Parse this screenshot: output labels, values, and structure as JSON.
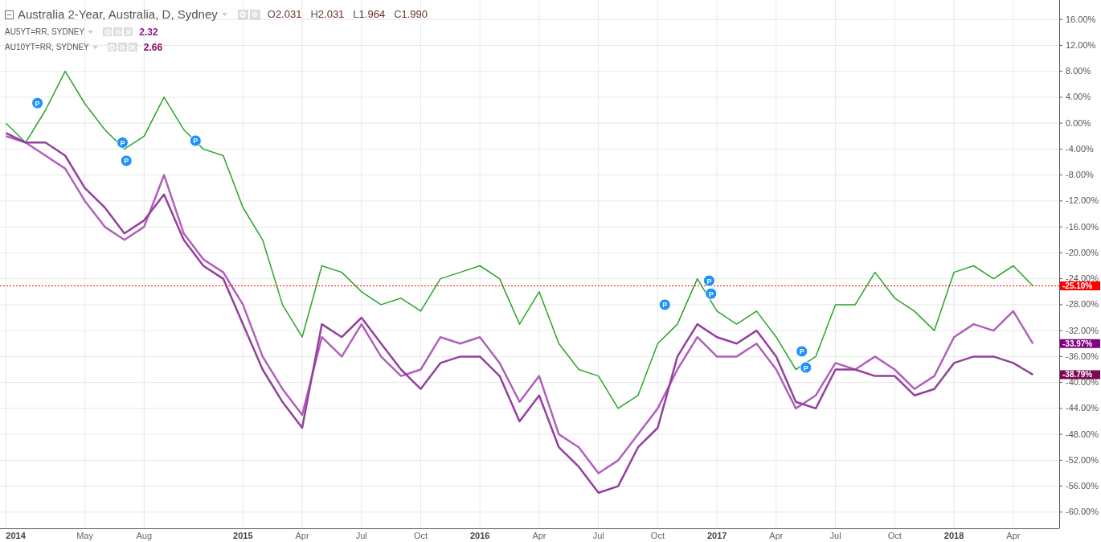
{
  "legend": {
    "main": {
      "title": "Australia 2-Year, Australia, D, Sydney",
      "ohlc": [
        {
          "label": "O",
          "value": "2.031"
        },
        {
          "label": "H",
          "value": "2.031"
        },
        {
          "label": "L",
          "value": "1.964"
        },
        {
          "label": "C",
          "value": "1.990"
        }
      ]
    },
    "compare": [
      {
        "title": "AU5YT=RR, SYDNEY",
        "value": "2.32",
        "color": "#8b1a8b"
      },
      {
        "title": "AU10YT=RR, SYDNEY",
        "value": "2.66",
        "color": "#8a0a5c"
      }
    ]
  },
  "chart_data": {
    "type": "line",
    "x": [
      2014,
      2014.083,
      2014.167,
      2014.25,
      2014.333,
      2014.417,
      2014.5,
      2014.583,
      2014.667,
      2014.75,
      2014.833,
      2014.917,
      2015,
      2015.083,
      2015.167,
      2015.25,
      2015.333,
      2015.417,
      2015.5,
      2015.583,
      2015.667,
      2015.75,
      2015.833,
      2015.917,
      2016,
      2016.083,
      2016.167,
      2016.25,
      2016.333,
      2016.417,
      2016.5,
      2016.583,
      2016.667,
      2016.75,
      2016.833,
      2016.917,
      2017,
      2017.083,
      2017.167,
      2017.25,
      2017.333,
      2017.417,
      2017.5,
      2017.583,
      2017.667,
      2017.75,
      2017.833,
      2017.917,
      2018,
      2018.083,
      2018.167,
      2018.25,
      2018.333
    ],
    "series": [
      {
        "color": "#2aa52a",
        "values": [
          0,
          -3,
          2,
          8,
          3,
          -1,
          -4,
          -2,
          4,
          -1,
          -4,
          -5,
          -13,
          -18,
          -28,
          -33,
          -22,
          -23,
          -26,
          -28,
          -27,
          -29,
          -24,
          -23,
          -22,
          -24,
          -31,
          -26,
          -34,
          -38,
          -39,
          -44,
          -42,
          -34,
          -31,
          -24,
          -29,
          -31,
          -29,
          -33,
          -38,
          -36,
          -28,
          -28,
          -23,
          -27,
          -29,
          -32,
          -23,
          -22,
          -24,
          -22,
          -25.1
        ]
      },
      {
        "color": "#b060bc",
        "values": [
          -2,
          -3,
          -5,
          -7,
          -12,
          -16,
          -18,
          -16,
          -8,
          -17,
          -21,
          -23,
          -28,
          -36,
          -41,
          -45,
          -33,
          -36,
          -31,
          -36,
          -39,
          -38,
          -33,
          -34,
          -33,
          -37,
          -43,
          -39,
          -48,
          -50,
          -54,
          -52,
          -48,
          -44,
          -38,
          -33,
          -36,
          -36,
          -34,
          -38,
          -44,
          -42,
          -37,
          -38,
          -36,
          -38,
          -41,
          -39,
          -33,
          -31,
          -32,
          -29,
          -34
        ]
      },
      {
        "color": "#93409d",
        "values": [
          -1.5,
          -3,
          -3,
          -5,
          -10,
          -13,
          -17,
          -15,
          -11,
          -18,
          -22,
          -24,
          -31,
          -38,
          -43,
          -47,
          -31,
          -33,
          -30,
          -34,
          -38,
          -41,
          -37,
          -36,
          -36,
          -39,
          -46,
          -42,
          -50,
          -53,
          -57,
          -56,
          -50,
          -47,
          -36,
          -31,
          -33,
          -34,
          -32,
          -36,
          -43,
          -44,
          -38,
          -38,
          -39,
          -39,
          -42,
          -41,
          -37,
          -36,
          -36,
          -37,
          -38.8
        ]
      }
    ],
    "grid": true,
    "ref_lines": [
      {
        "axis": "y",
        "value": -25.1,
        "label": "-25.10%",
        "color": "#ff0000"
      }
    ],
    "annotations": [
      {
        "x": 2014.133,
        "y": 3.1,
        "text": "P"
      },
      {
        "x": 2014.492,
        "y": -3,
        "text": "P"
      },
      {
        "x": 2014.508,
        "y": -5.8,
        "text": "P"
      },
      {
        "x": 2014.8,
        "y": -2.7,
        "text": "P"
      },
      {
        "x": 2016.78,
        "y": -28,
        "text": "P"
      },
      {
        "x": 2016.967,
        "y": -24.3,
        "text": "P"
      },
      {
        "x": 2016.975,
        "y": -26.3,
        "text": "P"
      },
      {
        "x": 2017.358,
        "y": -35.2,
        "text": "P"
      },
      {
        "x": 2017.375,
        "y": -37.7,
        "text": "P"
      }
    ],
    "xlim": [
      2013.975,
      2018.444
    ],
    "ylim": [
      -62.5,
      19
    ],
    "xticks": [
      {
        "value": 2014,
        "label": "2014"
      },
      {
        "value": 2014.333,
        "label": "May"
      },
      {
        "value": 2014.583,
        "label": "Aug"
      },
      {
        "value": 2015,
        "label": "2015"
      },
      {
        "value": 2015.25,
        "label": "Apr"
      },
      {
        "value": 2015.5,
        "label": "Jul"
      },
      {
        "value": 2015.75,
        "label": "Oct"
      },
      {
        "value": 2016,
        "label": "2016"
      },
      {
        "value": 2016.25,
        "label": "Apr"
      },
      {
        "value": 2016.5,
        "label": "Jul"
      },
      {
        "value": 2016.75,
        "label": "Oct"
      },
      {
        "value": 2017,
        "label": "2017"
      },
      {
        "value": 2017.25,
        "label": "Apr"
      },
      {
        "value": 2017.5,
        "label": "Jul"
      },
      {
        "value": 2017.75,
        "label": "Oct"
      },
      {
        "value": 2018,
        "label": "2018"
      },
      {
        "value": 2018.25,
        "label": "Apr"
      }
    ],
    "yticks": [
      {
        "value": 16,
        "label": "16.00%"
      },
      {
        "value": 12,
        "label": "12.00%"
      },
      {
        "value": 8,
        "label": "8.00%"
      },
      {
        "value": 4,
        "label": "4.00%"
      },
      {
        "value": 0,
        "label": "0.00%"
      },
      {
        "value": -4,
        "label": "-4.00%"
      },
      {
        "value": -8,
        "label": "-8.00%"
      },
      {
        "value": -12,
        "label": "-12.00%"
      },
      {
        "value": -16,
        "label": "-16.00%"
      },
      {
        "value": -20,
        "label": "-20.00%"
      },
      {
        "value": -24,
        "label": "-24.00%"
      },
      {
        "value": -28,
        "label": "-28.00%"
      },
      {
        "value": -32,
        "label": "-32.00%"
      },
      {
        "value": -36,
        "label": "-36.00%"
      },
      {
        "value": -40,
        "label": "-40.00%"
      },
      {
        "value": -44,
        "label": "-44.00%"
      },
      {
        "value": -48,
        "label": "-48.00%"
      },
      {
        "value": -52,
        "label": "-52.00%"
      },
      {
        "value": -56,
        "label": "-56.00%"
      },
      {
        "value": -60,
        "label": "-60.00%"
      }
    ]
  },
  "axis_badges": [
    {
      "label": "-33.97%",
      "color": "#800080"
    },
    {
      "label": "-38.79%",
      "color": "#7a0a52"
    }
  ]
}
